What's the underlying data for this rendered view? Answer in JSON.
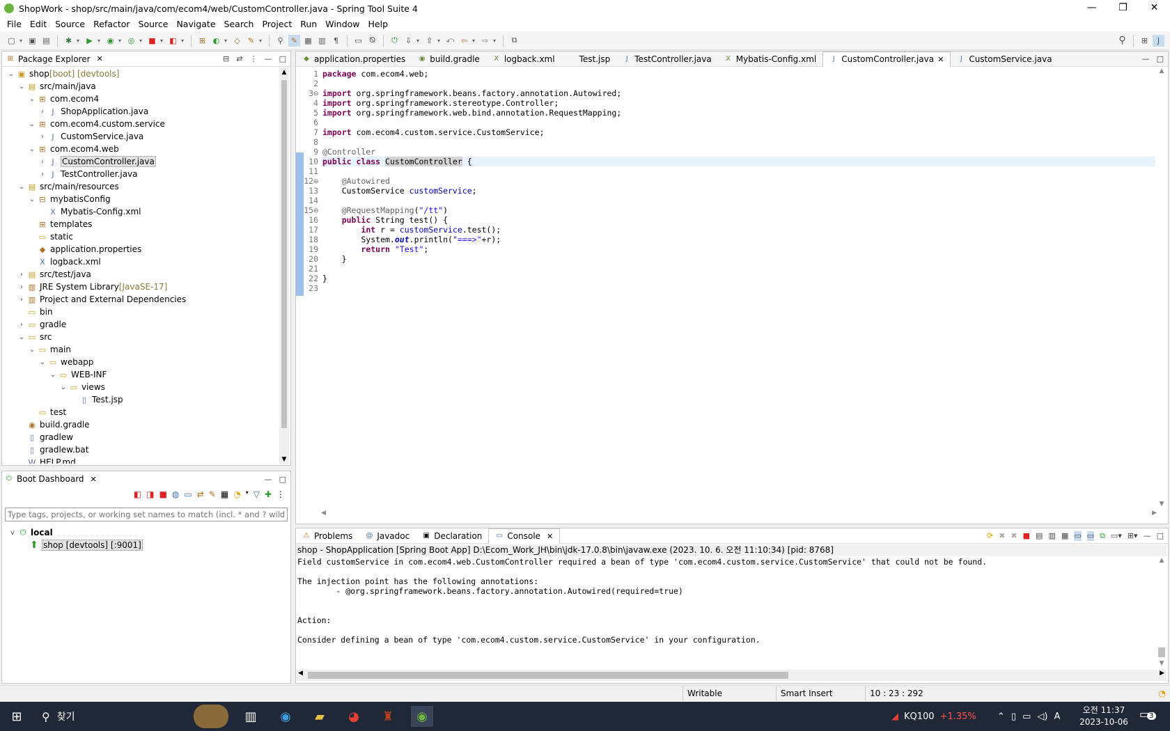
{
  "window": {
    "title": "ShopWork - shop/src/main/java/com/ecom4/web/CustomController.java - Spring Tool Suite 4"
  },
  "menu": [
    "File",
    "Edit",
    "Source",
    "Refactor",
    "Source",
    "Navigate",
    "Search",
    "Project",
    "Run",
    "Window",
    "Help"
  ],
  "package_explorer": {
    "title": "Package Explorer",
    "tree": [
      {
        "indent": 0,
        "twisty": "v",
        "icon": "▣",
        "cls": "folder",
        "label": "shop",
        "muted": " [boot] [devtools]"
      },
      {
        "indent": 1,
        "twisty": "v",
        "icon": "▤",
        "cls": "folder",
        "label": "src/main/java"
      },
      {
        "indent": 2,
        "twisty": "v",
        "icon": "⊞",
        "cls": "pkg",
        "label": "com.ecom4"
      },
      {
        "indent": 3,
        "twisty": ">",
        "icon": "J",
        "cls": "java",
        "label": "ShopApplication.java"
      },
      {
        "indent": 2,
        "twisty": "v",
        "icon": "⊞",
        "cls": "pkg",
        "label": "com.ecom4.custom.service"
      },
      {
        "indent": 3,
        "twisty": ">",
        "icon": "J",
        "cls": "java",
        "label": "CustomService.java"
      },
      {
        "indent": 2,
        "twisty": "v",
        "icon": "⊞",
        "cls": "pkg",
        "label": "com.ecom4.web"
      },
      {
        "indent": 3,
        "twisty": ">",
        "icon": "J",
        "cls": "java",
        "label": "CustomController.java",
        "selected": true
      },
      {
        "indent": 3,
        "twisty": ">",
        "icon": "J",
        "cls": "java",
        "label": "TestController.java"
      },
      {
        "indent": 1,
        "twisty": "v",
        "icon": "▤",
        "cls": "folder",
        "label": "src/main/resources"
      },
      {
        "indent": 2,
        "twisty": "v",
        "icon": "⊟",
        "cls": "pkg",
        "label": "mybatisConfig"
      },
      {
        "indent": 3,
        "twisty": "",
        "icon": "X",
        "cls": "java",
        "label": "Mybatis-Config.xml"
      },
      {
        "indent": 2,
        "twisty": "",
        "icon": "⊞",
        "cls": "pkg",
        "label": "templates"
      },
      {
        "indent": 2,
        "twisty": "",
        "icon": "▭",
        "cls": "folder",
        "label": "static"
      },
      {
        "indent": 2,
        "twisty": "",
        "icon": "◆",
        "cls": "pkg",
        "label": "application.properties"
      },
      {
        "indent": 2,
        "twisty": "",
        "icon": "X",
        "cls": "java",
        "label": "logback.xml"
      },
      {
        "indent": 1,
        "twisty": ">",
        "icon": "▤",
        "cls": "folder",
        "label": "src/test/java"
      },
      {
        "indent": 1,
        "twisty": ">",
        "icon": "▥",
        "cls": "pkg",
        "label": "JRE System Library",
        "muted": " [JavaSE-17]"
      },
      {
        "indent": 1,
        "twisty": ">",
        "icon": "▥",
        "cls": "pkg",
        "label": "Project and External Dependencies"
      },
      {
        "indent": 1,
        "twisty": "",
        "icon": "▭",
        "cls": "folder",
        "label": "bin"
      },
      {
        "indent": 1,
        "twisty": ">",
        "icon": "▭",
        "cls": "folder",
        "label": "gradle"
      },
      {
        "indent": 1,
        "twisty": "v",
        "icon": "▭",
        "cls": "folder",
        "label": "src"
      },
      {
        "indent": 2,
        "twisty": "v",
        "icon": "▭",
        "cls": "folder",
        "label": "main"
      },
      {
        "indent": 3,
        "twisty": "v",
        "icon": "▭",
        "cls": "folder",
        "label": "webapp"
      },
      {
        "indent": 4,
        "twisty": "v",
        "icon": "▭",
        "cls": "folder",
        "label": "WEB-INF"
      },
      {
        "indent": 5,
        "twisty": "v",
        "icon": "▭",
        "cls": "folder",
        "label": "views"
      },
      {
        "indent": 6,
        "twisty": "",
        "icon": "▯",
        "cls": "java",
        "label": "Test.jsp"
      },
      {
        "indent": 2,
        "twisty": "",
        "icon": "▭",
        "cls": "folder",
        "label": "test"
      },
      {
        "indent": 1,
        "twisty": "",
        "icon": "◉",
        "cls": "pkg",
        "label": "build.gradle"
      },
      {
        "indent": 1,
        "twisty": "",
        "icon": "▯",
        "cls": "java",
        "label": "gradlew"
      },
      {
        "indent": 1,
        "twisty": "",
        "icon": "▯",
        "cls": "java",
        "label": "gradlew.bat"
      },
      {
        "indent": 1,
        "twisty": "",
        "icon": "W",
        "cls": "java",
        "label": "HELP.md"
      }
    ]
  },
  "boot_dashboard": {
    "title": "Boot Dashboard",
    "filter_placeholder": "Type tags, projects, or working set names to match (incl. * and ? wildcards)",
    "local_label": "local",
    "app_label": "shop [devtools] [:9001]"
  },
  "editor": {
    "tabs": [
      {
        "label": "application.properties",
        "icon": "◆"
      },
      {
        "label": "build.gradle",
        "icon": "◉"
      },
      {
        "label": "logback.xml",
        "icon": "X"
      },
      {
        "label": "Test.jsp",
        "icon": ""
      },
      {
        "label": "TestController.java",
        "icon": "J"
      },
      {
        "label": "Mybatis-Config.xml",
        "icon": "X"
      },
      {
        "label": "CustomController.java",
        "icon": "J",
        "active": true
      },
      {
        "label": "CustomService.java",
        "icon": "J"
      }
    ],
    "lines": [
      {
        "n": "1",
        "html": "<span class='kw'>package</span> com.ecom4.web;"
      },
      {
        "n": "2",
        "html": ""
      },
      {
        "n": "3⊖",
        "html": "<span class='kw'>import</span> org.springframework.beans.factory.annotation.Autowired;"
      },
      {
        "n": "4",
        "html": "<span class='kw'>import</span> org.springframework.stereotype.Controller;"
      },
      {
        "n": "5",
        "html": "<span class='kw'>import</span> org.springframework.web.bind.annotation.RequestMapping;"
      },
      {
        "n": "6",
        "html": ""
      },
      {
        "n": "7",
        "html": "<span class='kw'>import</span> com.ecom4.custom.service.CustomService;"
      },
      {
        "n": "8",
        "html": ""
      },
      {
        "n": "9",
        "html": "<span class='ann'>@Controller</span>"
      },
      {
        "n": "10",
        "html": "<span class='kw'>public</span> <span class='kw'>class</span> <span style='background:#d4d4d4'>CustomController</span> {",
        "hl": true
      },
      {
        "n": "11",
        "html": ""
      },
      {
        "n": "12⊖",
        "html": "    <span class='ann'>@Autowired</span>"
      },
      {
        "n": "13",
        "html": "    CustomService <span class='fld'>customService</span>;"
      },
      {
        "n": "14",
        "html": ""
      },
      {
        "n": "15⊖",
        "html": "    <span class='ann'>@RequestMapping</span>(<span class='str'>\"/tt\"</span>)"
      },
      {
        "n": "16",
        "html": "    <span class='kw'>public</span> String test() {"
      },
      {
        "n": "17",
        "html": "        <span class='kw'>int</span> r = <span class='fld'>customService</span>.test();"
      },
      {
        "n": "18",
        "html": "        System.<span class='ital'>out</span>.println(<span class='str'>\"===>\"</span>+r);"
      },
      {
        "n": "19",
        "html": "        <span class='kw'>return</span> <span class='str'>\"Test\"</span>;"
      },
      {
        "n": "20",
        "html": "    }"
      },
      {
        "n": "21",
        "html": ""
      },
      {
        "n": "22",
        "html": "}"
      },
      {
        "n": "23",
        "html": ""
      }
    ]
  },
  "console": {
    "tabs": [
      "Problems",
      "Javadoc",
      "Declaration",
      "Console"
    ],
    "header": "shop - ShopApplication [Spring Boot App] D:\\Ecom_Work_JH\\bin\\jdk-17.0.8\\bin\\javaw.exe  (2023. 10. 6. 오전 11:10:34) [pid: 8768]",
    "lines": [
      "Field customService in com.ecom4.web.CustomController required a bean of type 'com.ecom4.custom.service.CustomService' that could not be found.",
      "",
      "The injection point has the following annotations:",
      "\t- @org.springframework.beans.factory.annotation.Autowired(required=true)",
      "",
      "",
      "Action:",
      "",
      "Consider defining a bean of type 'com.ecom4.custom.service.CustomService' in your configuration."
    ]
  },
  "status": {
    "writable": "Writable",
    "insert": "Smart Insert",
    "position": "10 : 23 : 292"
  },
  "taskbar": {
    "search_label": "찾기",
    "stock_name": "KQ100",
    "stock_change": "+1.35%",
    "time": "오전 11:37",
    "date": "2023-10-06",
    "notif_count": "3",
    "ime": "A"
  }
}
